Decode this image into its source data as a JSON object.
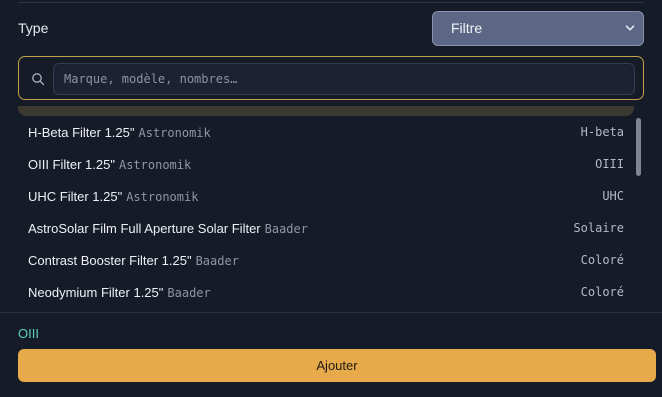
{
  "type_row": {
    "label": "Type",
    "select_value": "Filtre"
  },
  "search": {
    "placeholder": "Marque, modèle, nombres…",
    "value": ""
  },
  "list": {
    "items": [
      {
        "name": "H-Beta Filter 1.25\"",
        "brand": "Astronomik",
        "type": "H-beta"
      },
      {
        "name": "OIII Filter 1.25\"",
        "brand": "Astronomik",
        "type": "OIII"
      },
      {
        "name": "UHC Filter 1.25\"",
        "brand": "Astronomik",
        "type": "UHC"
      },
      {
        "name": "AstroSolar Film Full Aperture Solar Filter",
        "brand": "Baader",
        "type": "Solaire"
      },
      {
        "name": "Contrast Booster Filter 1.25\"",
        "brand": "Baader",
        "type": "Coloré"
      },
      {
        "name": "Neodymium Filter 1.25\"",
        "brand": "Baader",
        "type": "Coloré"
      }
    ]
  },
  "footer": {
    "selected": "OIII",
    "add_label": "Ajouter"
  },
  "colors": {
    "background": "#161b28",
    "accent_button": "#e6aa4a",
    "selected_text": "#58d3b8",
    "search_border": "#bfa24a"
  },
  "icons": {
    "search": "search-icon",
    "select_chevron": "chevron-down-icon"
  }
}
